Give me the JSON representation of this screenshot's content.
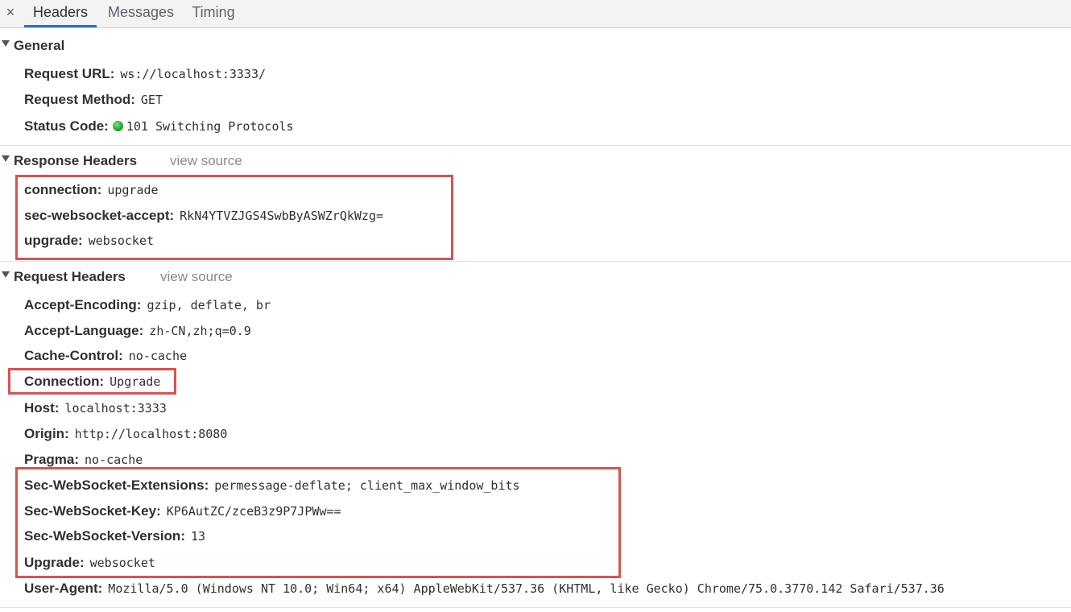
{
  "tabs": {
    "close_symbol": "×",
    "items": [
      "Headers",
      "Messages",
      "Timing"
    ],
    "active": "Headers"
  },
  "general": {
    "title": "General",
    "rows": [
      {
        "key": "Request URL:",
        "value": "ws://localhost:3333/"
      },
      {
        "key": "Request Method:",
        "value": "GET"
      },
      {
        "key": "Status Code:",
        "value": "101 Switching Protocols",
        "status_color": "#1fa51f"
      }
    ]
  },
  "response_headers": {
    "title": "Response Headers",
    "view_source": "view source",
    "rows": [
      {
        "key": "connection:",
        "value": "upgrade"
      },
      {
        "key": "sec-websocket-accept:",
        "value": "RkN4YTVZJGS4SwbByASWZrQkWzg="
      },
      {
        "key": "upgrade:",
        "value": "websocket"
      }
    ]
  },
  "request_headers": {
    "title": "Request Headers",
    "view_source": "view source",
    "rows": [
      {
        "key": "Accept-Encoding:",
        "value": "gzip, deflate, br"
      },
      {
        "key": "Accept-Language:",
        "value": "zh-CN,zh;q=0.9"
      },
      {
        "key": "Cache-Control:",
        "value": "no-cache"
      },
      {
        "key": "Connection:",
        "value": "Upgrade"
      },
      {
        "key": "Host:",
        "value": "localhost:3333"
      },
      {
        "key": "Origin:",
        "value": "http://localhost:8080"
      },
      {
        "key": "Pragma:",
        "value": "no-cache"
      },
      {
        "key": "Sec-WebSocket-Extensions:",
        "value": "permessage-deflate; client_max_window_bits"
      },
      {
        "key": "Sec-WebSocket-Key:",
        "value": "KP6AutZC/zceB3z9P7JPWw=="
      },
      {
        "key": "Sec-WebSocket-Version:",
        "value": "13"
      },
      {
        "key": "Upgrade:",
        "value": "websocket"
      },
      {
        "key": "User-Agent:",
        "value": "Mozilla/5.0 (Windows NT 10.0; Win64; x64) AppleWebKit/537.36 (KHTML, like Gecko) Chrome/75.0.3770.142 Safari/537.36"
      }
    ]
  },
  "colors": {
    "highlight": "#d9534f",
    "active_tab_underline": "#1a73e8",
    "status_ok": "#1fa51f"
  }
}
